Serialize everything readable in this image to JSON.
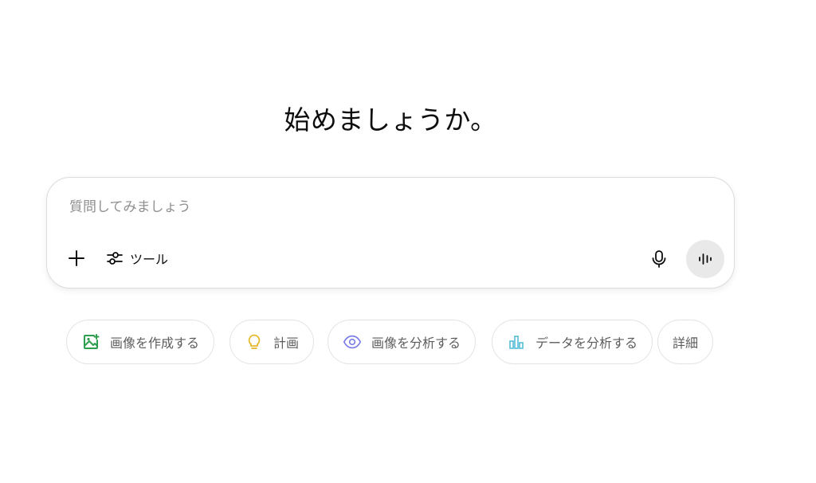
{
  "heading": "始めましょうか。",
  "composer": {
    "placeholder": "質問してみましょう",
    "tools_label": "ツール"
  },
  "suggestions": [
    {
      "label": "画像を作成する",
      "icon": "image-create-icon",
      "color": "#2e9e4f"
    },
    {
      "label": "計画",
      "icon": "lightbulb-icon",
      "color": "#e3b82b"
    },
    {
      "label": "画像を分析する",
      "icon": "eye-icon",
      "color": "#7b7ee8"
    },
    {
      "label": "データを分析する",
      "icon": "bar-chart-icon",
      "color": "#5fc0d8"
    },
    {
      "label": "詳細"
    }
  ]
}
